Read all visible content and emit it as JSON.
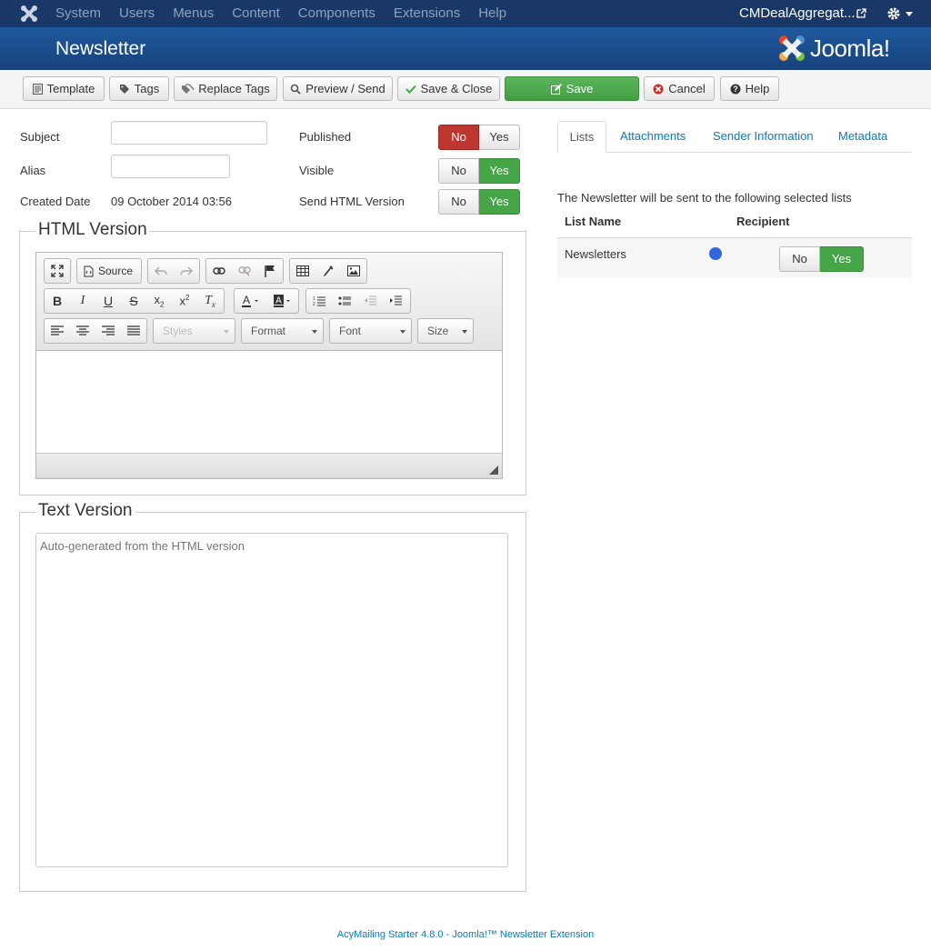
{
  "topnav": {
    "menu": [
      "System",
      "Users",
      "Menus",
      "Content",
      "Components",
      "Extensions",
      "Help"
    ],
    "site_name": "CMDealAggregat..."
  },
  "header": {
    "title": "Newsletter",
    "brand": "Joomla!"
  },
  "toolbar": {
    "template": "Template",
    "tags": "Tags",
    "replace_tags": "Replace Tags",
    "preview_send": "Preview / Send",
    "save_close": "Save & Close",
    "save": "Save",
    "cancel": "Cancel",
    "help": "Help"
  },
  "form": {
    "subject_label": "Subject",
    "subject_value": "",
    "alias_label": "Alias",
    "alias_value": "",
    "created_label": "Created Date",
    "created_value": "09 October 2014 03:56",
    "published_label": "Published",
    "visible_label": "Visible",
    "send_html_label": "Send HTML Version",
    "no": "No",
    "yes": "Yes"
  },
  "html_version": {
    "legend": "HTML Version",
    "source": "Source",
    "styles": "Styles",
    "format": "Format",
    "font": "Font",
    "size": "Size"
  },
  "text_version": {
    "legend": "Text Version",
    "placeholder": "Auto-generated from the HTML version"
  },
  "tabs": [
    "Lists",
    "Attachments",
    "Sender Information",
    "Metadata"
  ],
  "lists": {
    "intro": "The Newsletter will be sent to the following selected lists",
    "col_list_name": "List Name",
    "col_recipient": "Recipient",
    "rows": [
      {
        "name": "Newsletters",
        "color": "#3366dd"
      }
    ]
  },
  "footer": "AcyMailing Starter 4.8.0 - Joomla!™ Newsletter Extension",
  "colors": {
    "topnav": "#1a3867",
    "header": "#1a4d8c",
    "green": "#46a546",
    "red": "#bd362f",
    "link": "#0a7abf"
  }
}
